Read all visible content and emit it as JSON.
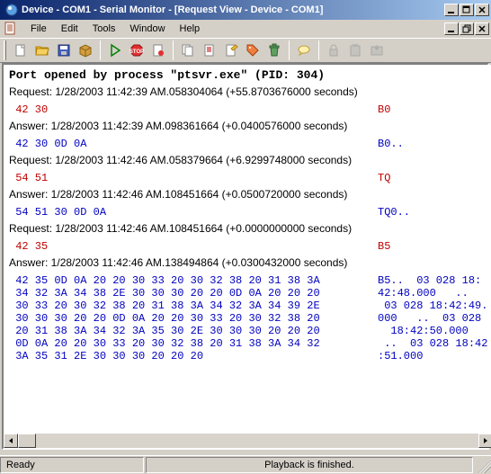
{
  "window": {
    "title": "Device - COM1 - Serial Monitor - [Request View - Device - COM1]"
  },
  "menu": {
    "file": "File",
    "edit": "Edit",
    "tools": "Tools",
    "window": "Window",
    "help": "Help"
  },
  "status": {
    "left": "Ready",
    "center": "Playback is finished."
  },
  "content": {
    "header": "Port opened by process \"ptsvr.exe\" (PID: 304)",
    "lines": [
      {
        "type": "info",
        "text": "Request: 1/28/2003 11:42:39 AM.058304064 (+55.8703676000 seconds)"
      },
      {
        "type": "hex",
        "color": "red",
        "hex": "42 30",
        "ascii": "B0"
      },
      {
        "type": "info",
        "text": "Answer: 1/28/2003 11:42:39 AM.098361664 (+0.0400576000 seconds)"
      },
      {
        "type": "hex",
        "color": "blue",
        "hex": "42 30 0D 0A",
        "ascii": "B0.."
      },
      {
        "type": "info",
        "text": "Request: 1/28/2003 11:42:46 AM.058379664 (+6.9299748000 seconds)"
      },
      {
        "type": "hex",
        "color": "red",
        "hex": "54 51",
        "ascii": "TQ"
      },
      {
        "type": "info",
        "text": "Answer: 1/28/2003 11:42:46 AM.108451664 (+0.0500720000 seconds)"
      },
      {
        "type": "hex",
        "color": "blue",
        "hex": "54 51 30 0D 0A",
        "ascii": "TQ0.."
      },
      {
        "type": "info",
        "text": "Request: 1/28/2003 11:42:46 AM.108451664 (+0.0000000000 seconds)"
      },
      {
        "type": "hex",
        "color": "red",
        "hex": "42 35",
        "ascii": "B5"
      },
      {
        "type": "info",
        "text": "Answer: 1/28/2003 11:42:46 AM.138494864 (+0.0300432000 seconds)"
      },
      {
        "type": "hex",
        "color": "blue",
        "hex": "42 35 0D 0A 20 20 30 33 20 30 32 38 20 31 38 3A",
        "ascii": "B5..  03 028 18:"
      },
      {
        "type": "hex",
        "color": "blue",
        "hex": "34 32 3A 34 38 2E 30 30 30 20 20 0D 0A 20 20 20",
        "ascii": "42:48.000   ..  "
      },
      {
        "type": "hex",
        "color": "blue",
        "hex": "30 33 20 30 32 38 20 31 38 3A 34 32 3A 34 39 2E",
        "ascii": " 03 028 18:42:49."
      },
      {
        "type": "hex",
        "color": "blue",
        "hex": "30 30 30 20 20 0D 0A 20 20 30 33 20 30 32 38 20",
        "ascii": "000   ..  03 028"
      },
      {
        "type": "hex",
        "color": "blue",
        "hex": "20 31 38 3A 34 32 3A 35 30 2E 30 30 30 20 20 20",
        "ascii": "  18:42:50.000  "
      },
      {
        "type": "hex",
        "color": "blue",
        "hex": "0D 0A 20 20 30 33 20 30 32 38 20 31 38 3A 34 32",
        "ascii": " ..  03 028 18:42"
      },
      {
        "type": "hex",
        "color": "blue",
        "hex": "3A 35 31 2E 30 30 30 20 20 20",
        "ascii": ":51.000   "
      }
    ]
  }
}
